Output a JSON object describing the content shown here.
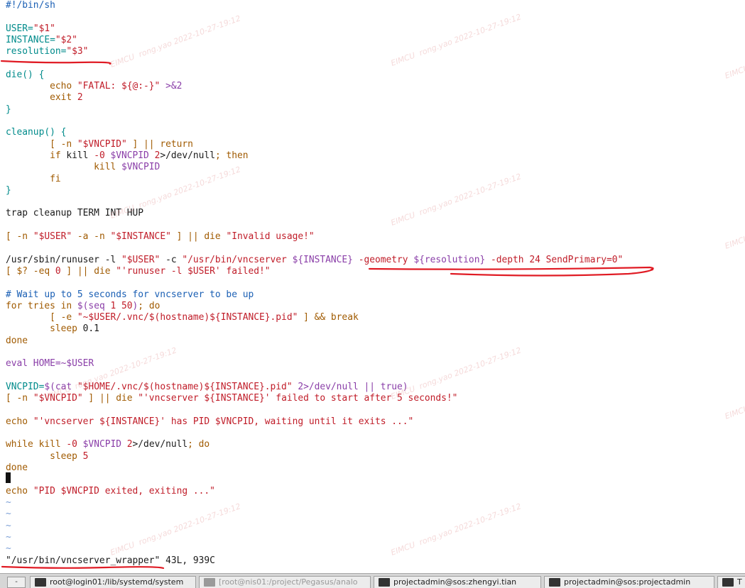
{
  "editor": {
    "lines": [
      [
        {
          "t": "#!/bin/sh",
          "c": "#1a5fb4"
        }
      ],
      [],
      [
        {
          "t": "USER=",
          "c": "#008b8b"
        },
        {
          "t": "\"$1\"",
          "c": "#c01c28"
        }
      ],
      [
        {
          "t": "INSTANCE=",
          "c": "#008b8b"
        },
        {
          "t": "\"$2\"",
          "c": "#c01c28"
        }
      ],
      [
        {
          "t": "resolution=",
          "c": "#008b8b"
        },
        {
          "t": "\"$3\"",
          "c": "#c01c28"
        }
      ],
      [],
      [
        {
          "t": "die() {",
          "c": "#008b8b"
        }
      ],
      [
        {
          "t": "        echo ",
          "c": "#a05a00"
        },
        {
          "t": "\"FATAL: ${@:-}\"",
          "c": "#c01c28"
        },
        {
          "t": " >&2",
          "c": "#8a3ea8"
        }
      ],
      [
        {
          "t": "        exit ",
          "c": "#a05a00"
        },
        {
          "t": "2",
          "c": "#c01c28"
        }
      ],
      [
        {
          "t": "}",
          "c": "#008b8b"
        }
      ],
      [],
      [
        {
          "t": "cleanup() {",
          "c": "#008b8b"
        }
      ],
      [
        {
          "t": "        [ -n ",
          "c": "#a05a00"
        },
        {
          "t": "\"$VNCPID\"",
          "c": "#c01c28"
        },
        {
          "t": " ] || return",
          "c": "#a05a00"
        }
      ],
      [
        {
          "t": "        if ",
          "c": "#a05a00"
        },
        {
          "t": "kill ",
          "c": "#1a1a1a"
        },
        {
          "t": "-0 ",
          "c": "#c01c28"
        },
        {
          "t": "$VNCPID ",
          "c": "#8a3ea8"
        },
        {
          "t": "2",
          "c": "#c01c28"
        },
        {
          "t": ">/dev/null",
          "c": "#1a1a1a"
        },
        {
          "t": "; then",
          "c": "#a05a00"
        }
      ],
      [
        {
          "t": "                kill ",
          "c": "#a05a00"
        },
        {
          "t": "$VNCPID",
          "c": "#8a3ea8"
        }
      ],
      [
        {
          "t": "        fi",
          "c": "#a05a00"
        }
      ],
      [
        {
          "t": "}",
          "c": "#008b8b"
        }
      ],
      [],
      [
        {
          "t": "trap cleanup TERM INT HUP",
          "c": "#1a1a1a"
        }
      ],
      [],
      [
        {
          "t": "[ -n ",
          "c": "#a05a00"
        },
        {
          "t": "\"$USER\"",
          "c": "#c01c28"
        },
        {
          "t": " -a -n ",
          "c": "#a05a00"
        },
        {
          "t": "\"$INSTANCE\"",
          "c": "#c01c28"
        },
        {
          "t": " ] || die ",
          "c": "#a05a00"
        },
        {
          "t": "\"Invalid usage!\"",
          "c": "#c01c28"
        }
      ],
      [],
      [
        {
          "t": "/usr/sbin/runuser -l ",
          "c": "#1a1a1a"
        },
        {
          "t": "\"$USER\"",
          "c": "#c01c28"
        },
        {
          "t": " -c ",
          "c": "#1a1a1a"
        },
        {
          "t": "\"/usr/bin/vncserver ",
          "c": "#c01c28"
        },
        {
          "t": "${INSTANCE}",
          "c": "#8a3ea8"
        },
        {
          "t": " -geometry ",
          "c": "#c01c28"
        },
        {
          "t": "${resolution}",
          "c": "#8a3ea8"
        },
        {
          "t": " -depth 24 SendPrimary=0\"",
          "c": "#c01c28"
        }
      ],
      [
        {
          "t": "[ $? -eq ",
          "c": "#a05a00"
        },
        {
          "t": "0",
          "c": "#c01c28"
        },
        {
          "t": " ] || die ",
          "c": "#a05a00"
        },
        {
          "t": "\"'runuser -l $USER' failed!\"",
          "c": "#c01c28"
        }
      ],
      [],
      [
        {
          "t": "# Wait up to 5 seconds for vncserver to be up",
          "c": "#1a5fb4"
        }
      ],
      [
        {
          "t": "for tries in ",
          "c": "#a05a00"
        },
        {
          "t": "$(seq ",
          "c": "#8a3ea8"
        },
        {
          "t": "1 50",
          "c": "#c01c28"
        },
        {
          "t": ")",
          "c": "#8a3ea8"
        },
        {
          "t": "; do",
          "c": "#a05a00"
        }
      ],
      [
        {
          "t": "        [ -e ",
          "c": "#a05a00"
        },
        {
          "t": "\"~$USER/.vnc/$(hostname)${INSTANCE}.pid\"",
          "c": "#c01c28"
        },
        {
          "t": " ] && break",
          "c": "#a05a00"
        }
      ],
      [
        {
          "t": "        sleep ",
          "c": "#a05a00"
        },
        {
          "t": "0.1",
          "c": "#1a1a1a"
        }
      ],
      [
        {
          "t": "done",
          "c": "#a05a00"
        }
      ],
      [],
      [
        {
          "t": "eval HOME=~$USER",
          "c": "#8a3ea8"
        }
      ],
      [],
      [
        {
          "t": "VNCPID=",
          "c": "#008b8b"
        },
        {
          "t": "$(cat ",
          "c": "#8a3ea8"
        },
        {
          "t": "\"$HOME/.vnc/$(hostname)${INSTANCE}.pid\"",
          "c": "#c01c28"
        },
        {
          "t": " 2>/dev/null || true)",
          "c": "#8a3ea8"
        }
      ],
      [
        {
          "t": "[ -n ",
          "c": "#a05a00"
        },
        {
          "t": "\"$VNCPID\"",
          "c": "#c01c28"
        },
        {
          "t": " ] || die ",
          "c": "#a05a00"
        },
        {
          "t": "\"'vncserver ${INSTANCE}' failed to start after 5 seconds!\"",
          "c": "#c01c28"
        }
      ],
      [],
      [
        {
          "t": "echo ",
          "c": "#a05a00"
        },
        {
          "t": "\"'vncserver ${INSTANCE}' has PID $VNCPID, waiting until it exits ...\"",
          "c": "#c01c28"
        }
      ],
      [],
      [
        {
          "t": "while kill ",
          "c": "#a05a00"
        },
        {
          "t": "-0 ",
          "c": "#c01c28"
        },
        {
          "t": "$VNCPID ",
          "c": "#8a3ea8"
        },
        {
          "t": "2",
          "c": "#c01c28"
        },
        {
          "t": ">/dev/null",
          "c": "#1a1a1a"
        },
        {
          "t": "; do",
          "c": "#a05a00"
        }
      ],
      [
        {
          "t": "        sleep ",
          "c": "#a05a00"
        },
        {
          "t": "5",
          "c": "#c01c28"
        }
      ],
      [
        {
          "t": "done",
          "c": "#a05a00"
        }
      ],
      [],
      [
        {
          "t": "echo ",
          "c": "#a05a00"
        },
        {
          "t": "\"PID $VNCPID exited, exiting ...\"",
          "c": "#c01c28"
        }
      ]
    ],
    "tilde_lines": [
      "~",
      "~",
      "~",
      "~",
      "~"
    ],
    "status": {
      "filename": "\"/usr/bin/vncserver_wrapper\"",
      "info": " 43L, 939C"
    }
  },
  "watermark": {
    "name": "rong.yao",
    "date": "2022-10-27-19:12",
    "brand": "EIMCU"
  },
  "taskbar": {
    "system_button": "-",
    "tasks": [
      {
        "label": "root@login01:/lib/systemd/system"
      },
      {
        "label": "[root@nis01:/project/Pegasus/analo"
      },
      {
        "label": "projectadmin@sos:zhengyi.tian"
      },
      {
        "label": "projectadmin@sos:projectadmin"
      },
      {
        "label": "T"
      }
    ]
  },
  "colors": {
    "annotation_underline": "#e01b24",
    "comment": "#1a5fb4",
    "variable": "#008b8b",
    "string": "#c01c28",
    "keyword": "#a05a00",
    "expansion": "#8a3ea8"
  }
}
